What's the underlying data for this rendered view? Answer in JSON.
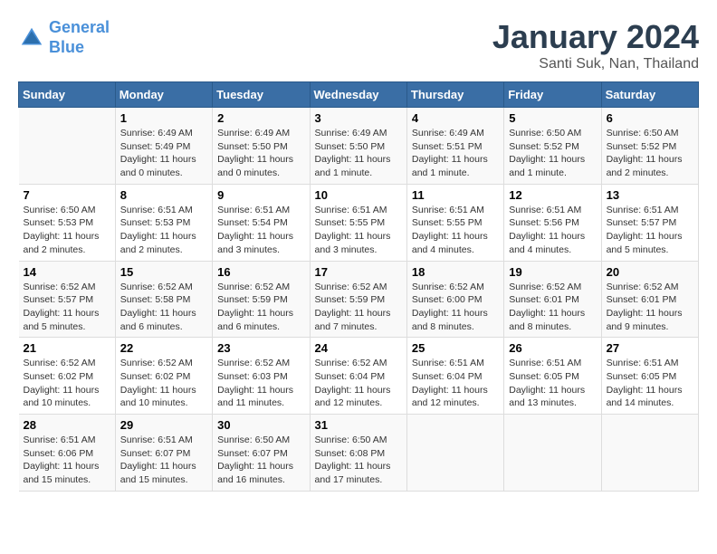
{
  "header": {
    "logo_line1": "General",
    "logo_line2": "Blue",
    "title": "January 2024",
    "subtitle": "Santi Suk, Nan, Thailand"
  },
  "calendar": {
    "days_of_week": [
      "Sunday",
      "Monday",
      "Tuesday",
      "Wednesday",
      "Thursday",
      "Friday",
      "Saturday"
    ],
    "weeks": [
      [
        {
          "day": "",
          "info": ""
        },
        {
          "day": "1",
          "info": "Sunrise: 6:49 AM\nSunset: 5:49 PM\nDaylight: 11 hours\nand 0 minutes."
        },
        {
          "day": "2",
          "info": "Sunrise: 6:49 AM\nSunset: 5:50 PM\nDaylight: 11 hours\nand 0 minutes."
        },
        {
          "day": "3",
          "info": "Sunrise: 6:49 AM\nSunset: 5:50 PM\nDaylight: 11 hours\nand 1 minute."
        },
        {
          "day": "4",
          "info": "Sunrise: 6:49 AM\nSunset: 5:51 PM\nDaylight: 11 hours\nand 1 minute."
        },
        {
          "day": "5",
          "info": "Sunrise: 6:50 AM\nSunset: 5:52 PM\nDaylight: 11 hours\nand 1 minute."
        },
        {
          "day": "6",
          "info": "Sunrise: 6:50 AM\nSunset: 5:52 PM\nDaylight: 11 hours\nand 2 minutes."
        }
      ],
      [
        {
          "day": "7",
          "info": "Sunrise: 6:50 AM\nSunset: 5:53 PM\nDaylight: 11 hours\nand 2 minutes."
        },
        {
          "day": "8",
          "info": "Sunrise: 6:51 AM\nSunset: 5:53 PM\nDaylight: 11 hours\nand 2 minutes."
        },
        {
          "day": "9",
          "info": "Sunrise: 6:51 AM\nSunset: 5:54 PM\nDaylight: 11 hours\nand 3 minutes."
        },
        {
          "day": "10",
          "info": "Sunrise: 6:51 AM\nSunset: 5:55 PM\nDaylight: 11 hours\nand 3 minutes."
        },
        {
          "day": "11",
          "info": "Sunrise: 6:51 AM\nSunset: 5:55 PM\nDaylight: 11 hours\nand 4 minutes."
        },
        {
          "day": "12",
          "info": "Sunrise: 6:51 AM\nSunset: 5:56 PM\nDaylight: 11 hours\nand 4 minutes."
        },
        {
          "day": "13",
          "info": "Sunrise: 6:51 AM\nSunset: 5:57 PM\nDaylight: 11 hours\nand 5 minutes."
        }
      ],
      [
        {
          "day": "14",
          "info": "Sunrise: 6:52 AM\nSunset: 5:57 PM\nDaylight: 11 hours\nand 5 minutes."
        },
        {
          "day": "15",
          "info": "Sunrise: 6:52 AM\nSunset: 5:58 PM\nDaylight: 11 hours\nand 6 minutes."
        },
        {
          "day": "16",
          "info": "Sunrise: 6:52 AM\nSunset: 5:59 PM\nDaylight: 11 hours\nand 6 minutes."
        },
        {
          "day": "17",
          "info": "Sunrise: 6:52 AM\nSunset: 5:59 PM\nDaylight: 11 hours\nand 7 minutes."
        },
        {
          "day": "18",
          "info": "Sunrise: 6:52 AM\nSunset: 6:00 PM\nDaylight: 11 hours\nand 8 minutes."
        },
        {
          "day": "19",
          "info": "Sunrise: 6:52 AM\nSunset: 6:01 PM\nDaylight: 11 hours\nand 8 minutes."
        },
        {
          "day": "20",
          "info": "Sunrise: 6:52 AM\nSunset: 6:01 PM\nDaylight: 11 hours\nand 9 minutes."
        }
      ],
      [
        {
          "day": "21",
          "info": "Sunrise: 6:52 AM\nSunset: 6:02 PM\nDaylight: 11 hours\nand 10 minutes."
        },
        {
          "day": "22",
          "info": "Sunrise: 6:52 AM\nSunset: 6:02 PM\nDaylight: 11 hours\nand 10 minutes."
        },
        {
          "day": "23",
          "info": "Sunrise: 6:52 AM\nSunset: 6:03 PM\nDaylight: 11 hours\nand 11 minutes."
        },
        {
          "day": "24",
          "info": "Sunrise: 6:52 AM\nSunset: 6:04 PM\nDaylight: 11 hours\nand 12 minutes."
        },
        {
          "day": "25",
          "info": "Sunrise: 6:51 AM\nSunset: 6:04 PM\nDaylight: 11 hours\nand 12 minutes."
        },
        {
          "day": "26",
          "info": "Sunrise: 6:51 AM\nSunset: 6:05 PM\nDaylight: 11 hours\nand 13 minutes."
        },
        {
          "day": "27",
          "info": "Sunrise: 6:51 AM\nSunset: 6:05 PM\nDaylight: 11 hours\nand 14 minutes."
        }
      ],
      [
        {
          "day": "28",
          "info": "Sunrise: 6:51 AM\nSunset: 6:06 PM\nDaylight: 11 hours\nand 15 minutes."
        },
        {
          "day": "29",
          "info": "Sunrise: 6:51 AM\nSunset: 6:07 PM\nDaylight: 11 hours\nand 15 minutes."
        },
        {
          "day": "30",
          "info": "Sunrise: 6:50 AM\nSunset: 6:07 PM\nDaylight: 11 hours\nand 16 minutes."
        },
        {
          "day": "31",
          "info": "Sunrise: 6:50 AM\nSunset: 6:08 PM\nDaylight: 11 hours\nand 17 minutes."
        },
        {
          "day": "",
          "info": ""
        },
        {
          "day": "",
          "info": ""
        },
        {
          "day": "",
          "info": ""
        }
      ]
    ]
  }
}
